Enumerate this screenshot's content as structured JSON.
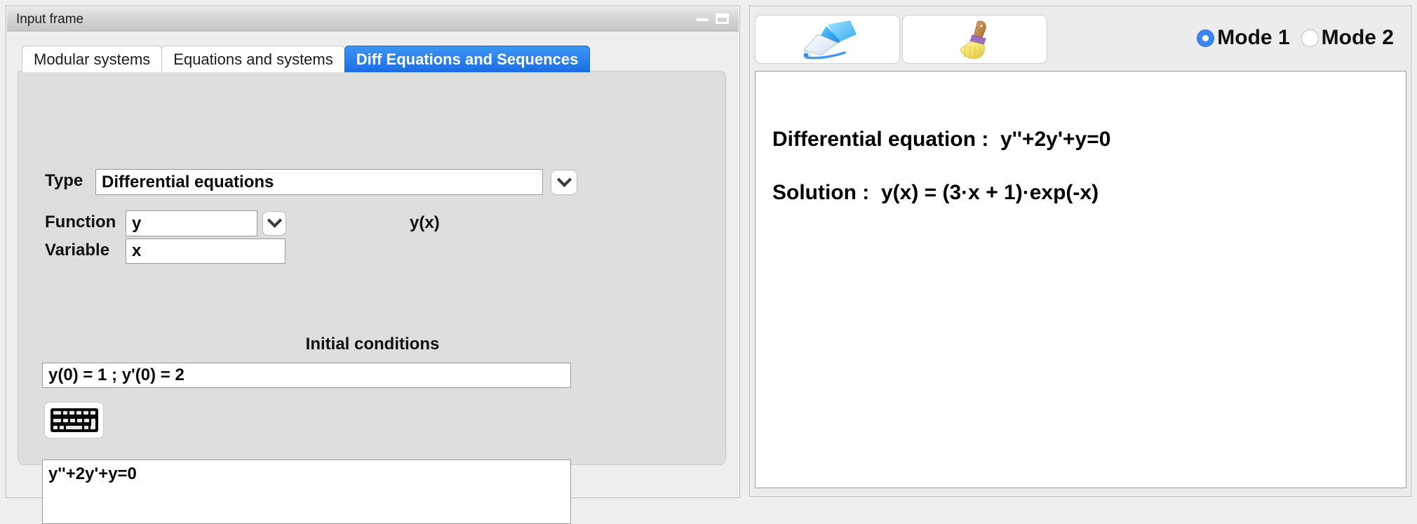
{
  "window": {
    "title": "Input frame",
    "minimize_icon": "minimize-icon",
    "maximize_icon": "maximize-icon"
  },
  "tabs": [
    {
      "label": "Modular systems",
      "selected": false
    },
    {
      "label": "Equations and systems",
      "selected": false
    },
    {
      "label": "Diff Equations and Sequences",
      "selected": true
    }
  ],
  "form": {
    "type_label": "Type",
    "type_value": "Differential equations",
    "function_label": "Function",
    "function_value": "y",
    "function_display": "y(x)",
    "variable_label": "Variable",
    "variable_value": "x",
    "initial_conditions_title": "Initial conditions",
    "initial_conditions_value": "y(0) = 1 ; y'(0) = 2",
    "equation_value": "y''+2y'+y=0",
    "keyboard_button_icon": "keyboard-icon",
    "dropdown_icon": "chevron-down-icon"
  },
  "output": {
    "toolbar": [
      {
        "name": "pen-tool-button",
        "icon": "pen-icon"
      },
      {
        "name": "clear-tool-button",
        "icon": "broom-icon"
      }
    ],
    "mode1_label": "Mode 1",
    "mode2_label": "Mode 2",
    "mode1_selected": true,
    "mode2_selected": false,
    "lines": [
      "Differential equation :  y''+2y'+y=0",
      "Solution :  y(x) = (3·x + 1)·exp(-x)"
    ]
  },
  "colors": {
    "accent_blue": "#3b86f0",
    "tab_selected_blue": "#1a6fe0",
    "panel_gray": "#dededf",
    "window_gray": "#eeeeee"
  }
}
